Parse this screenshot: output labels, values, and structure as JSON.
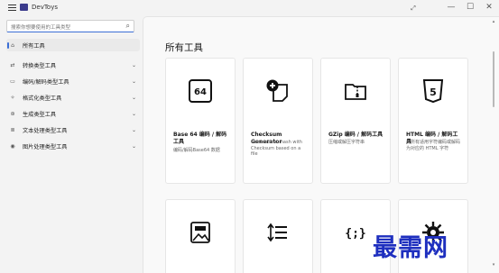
{
  "window": {
    "title": "DevToys",
    "controls": {
      "minimize": "—",
      "maximize": "☐",
      "close": "✕"
    }
  },
  "search": {
    "placeholder": "搜索你想要使用的工具类型"
  },
  "sidebar": {
    "items": [
      {
        "label": "所有工具",
        "icon": "home-icon",
        "active": true,
        "expandable": false
      },
      {
        "label": "转换类型工具",
        "icon": "converter-icon",
        "expandable": true
      },
      {
        "label": "编码/解码类型工具",
        "icon": "encoder-icon",
        "expandable": true
      },
      {
        "label": "格式化类型工具",
        "icon": "formatter-icon",
        "expandable": true
      },
      {
        "label": "生成类型工具",
        "icon": "generator-icon",
        "expandable": true
      },
      {
        "label": "文本处理类型工具",
        "icon": "text-icon",
        "expandable": true
      },
      {
        "label": "图片处理类型工具",
        "icon": "image-icon",
        "expandable": true
      }
    ]
  },
  "main": {
    "title": "所有工具",
    "cards": [
      {
        "title": "Base 64 编码 / 解码工具",
        "desc": "编码/解码Base64 数据",
        "icon": "base64-icon"
      },
      {
        "title": "Checksum Generator",
        "desc": "Generate an hash with Checksum based on a file",
        "icon": "checksum-icon"
      },
      {
        "title": "GZip 编码 / 解码工具",
        "desc": "压缩或解压字符串",
        "icon": "zip-icon"
      },
      {
        "title": "HTML 编码 / 解码工具",
        "desc": "将所有适用字符编码或解码为对应的 HTML 字符",
        "icon": "html5-icon"
      },
      {
        "title": "",
        "desc": "",
        "icon": "image-converter-icon"
      },
      {
        "title": "",
        "desc": "",
        "icon": "indent-icon"
      },
      {
        "title": "",
        "desc": "",
        "icon": "json-icon"
      },
      {
        "title": "",
        "desc": "",
        "icon": "gear-icon"
      }
    ]
  },
  "watermark": {
    "text": "最需网"
  },
  "colors": {
    "accent": "#3b6fd6",
    "watermark": "#1e2fbf"
  }
}
